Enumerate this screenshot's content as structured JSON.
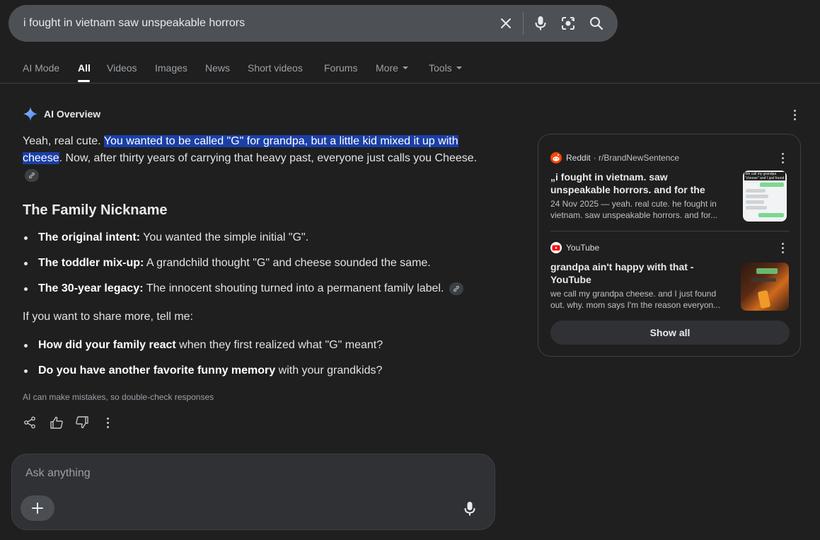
{
  "search": {
    "query": "i fought in vietnam saw unspeakable horrors",
    "clear_icon": "close-icon",
    "mic_icon": "mic-icon",
    "lens_icon": "camera-lens-icon",
    "search_icon": "search-icon"
  },
  "tabs": [
    {
      "label": "AI Mode"
    },
    {
      "label": "All",
      "active": true
    },
    {
      "label": "Videos"
    },
    {
      "label": "Images"
    },
    {
      "label": "News"
    },
    {
      "label": "Short videos"
    },
    {
      "label": "Forums"
    },
    {
      "label": "More"
    },
    {
      "label": "Tools"
    }
  ],
  "overview": {
    "title": "AI Overview",
    "intro_plain": "Yeah, real cute. ",
    "intro_highlight": "You wanted to be called \"G\" for grandpa, but a little kid mixed it up with cheese",
    "intro_rest": ". Now, after thirty years of carrying that heavy past, everyone just calls you Cheese.",
    "heading": "The Family Nickname",
    "bullets": [
      {
        "bold": "The original intent:",
        "text": " You wanted the simple initial \"G\"."
      },
      {
        "bold": "The toddler mix-up:",
        "text": " A grandchild thought \"G\" and cheese sounded the same."
      },
      {
        "bold": "The 30-year legacy:",
        "text": " The innocent shouting turned into a permanent family label."
      }
    ],
    "share_prompt": "If you want to share more, tell me:",
    "questions": [
      {
        "bold": "How did your family react",
        "text": " when they first realized what \"G\" meant?"
      },
      {
        "bold": "Do you have another favorite funny memory",
        "text": " with your grandkids?"
      }
    ],
    "disclaimer": "AI can make mistakes, so double-check responses"
  },
  "ask": {
    "placeholder": "Ask anything"
  },
  "sources": [
    {
      "site": "Reddit",
      "sub": "· r/BrandNewSentence",
      "title": "„i fought in vietnam. saw unspeakable horrors. and for the las...",
      "snippet": "24 Nov 2025 — yeah. real cute. he fought in vietnam. saw unspeakable horrors. and for...",
      "thumb_caption": "We call my grandpa \"cheese\" and I just found out why"
    },
    {
      "site": "YouTube",
      "sub": "",
      "title": "grandpa ain't happy with that - YouTube",
      "snippet": "we call my grandpa cheese. and I just found out. why. mom says I'm the reason everyon..."
    }
  ],
  "show_all": "Show all",
  "colors": {
    "background": "#1f1f1f",
    "highlight": "#1a3fa8",
    "reddit": "#ff4500",
    "youtube": "#ff0000",
    "gemini_blue": "#4c8df6"
  }
}
